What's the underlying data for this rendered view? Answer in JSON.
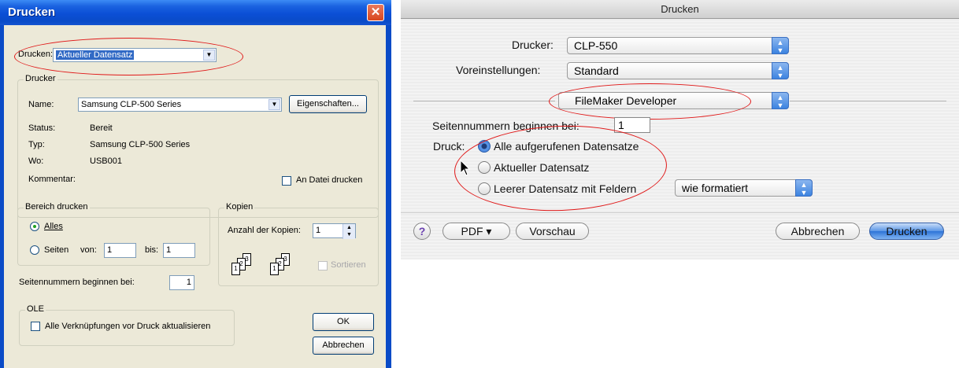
{
  "win": {
    "title": "Drucken",
    "close_glyph": "✕",
    "drucken_label": "Drucken:",
    "drucken_value": "Aktueller Datensatz",
    "drucker_group": "Drucker",
    "name_label": "Name:",
    "name_value": "Samsung CLP-500 Series",
    "eigenschaften_button": "Eigenschaften...",
    "status_label": "Status:",
    "status_value": "Bereit",
    "typ_label": "Typ:",
    "typ_value": "Samsung CLP-500 Series",
    "wo_label": "Wo:",
    "wo_value": "USB001",
    "kommentar_label": "Kommentar:",
    "an_datei_label": "An Datei drucken",
    "bereich_group": "Bereich drucken",
    "alles_label": "Alles",
    "seiten_label": "Seiten",
    "von_label": "von:",
    "von_value": "1",
    "bis_label": "bis:",
    "bis_value": "1",
    "kopien_group": "Kopien",
    "anzahl_label": "Anzahl der Kopien:",
    "anzahl_value": "1",
    "sortieren_label": "Sortieren",
    "collate_pages": [
      "1",
      "2",
      "3"
    ],
    "seitennummern_label": "Seitennummern beginnen bei:",
    "seitennummern_value": "1",
    "ole_group": "OLE",
    "ole_label": "Alle Verknüpfungen vor Druck aktualisieren",
    "ok_button": "OK",
    "abbrechen_button": "Abbrechen"
  },
  "mac": {
    "title": "Drucken",
    "drucker_label": "Drucker:",
    "drucker_value": "CLP-550",
    "voreinstellungen_label": "Voreinstellungen:",
    "voreinstellungen_value": "Standard",
    "panel_value": "FileMaker Developer",
    "seitennummern_label": "Seitennummern beginnen bei:",
    "seitennummern_value": "1",
    "druck_label": "Druck:",
    "radio_alle": "Alle aufgerufenen Datensatze",
    "radio_aktueller": "Aktueller Datensatz",
    "radio_leerer": "Leerer Datensatz mit Feldern",
    "format_value": "wie formatiert",
    "help_glyph": "?",
    "pdf_button": "PDF ▾",
    "vorschau_button": "Vorschau",
    "abbrechen_button": "Abbrechen",
    "drucken_button": "Drucken"
  },
  "colors": {
    "annotation": "#e01818",
    "xp_title": "#0a4bc7",
    "mac_default_button": "#3a7ce0"
  }
}
